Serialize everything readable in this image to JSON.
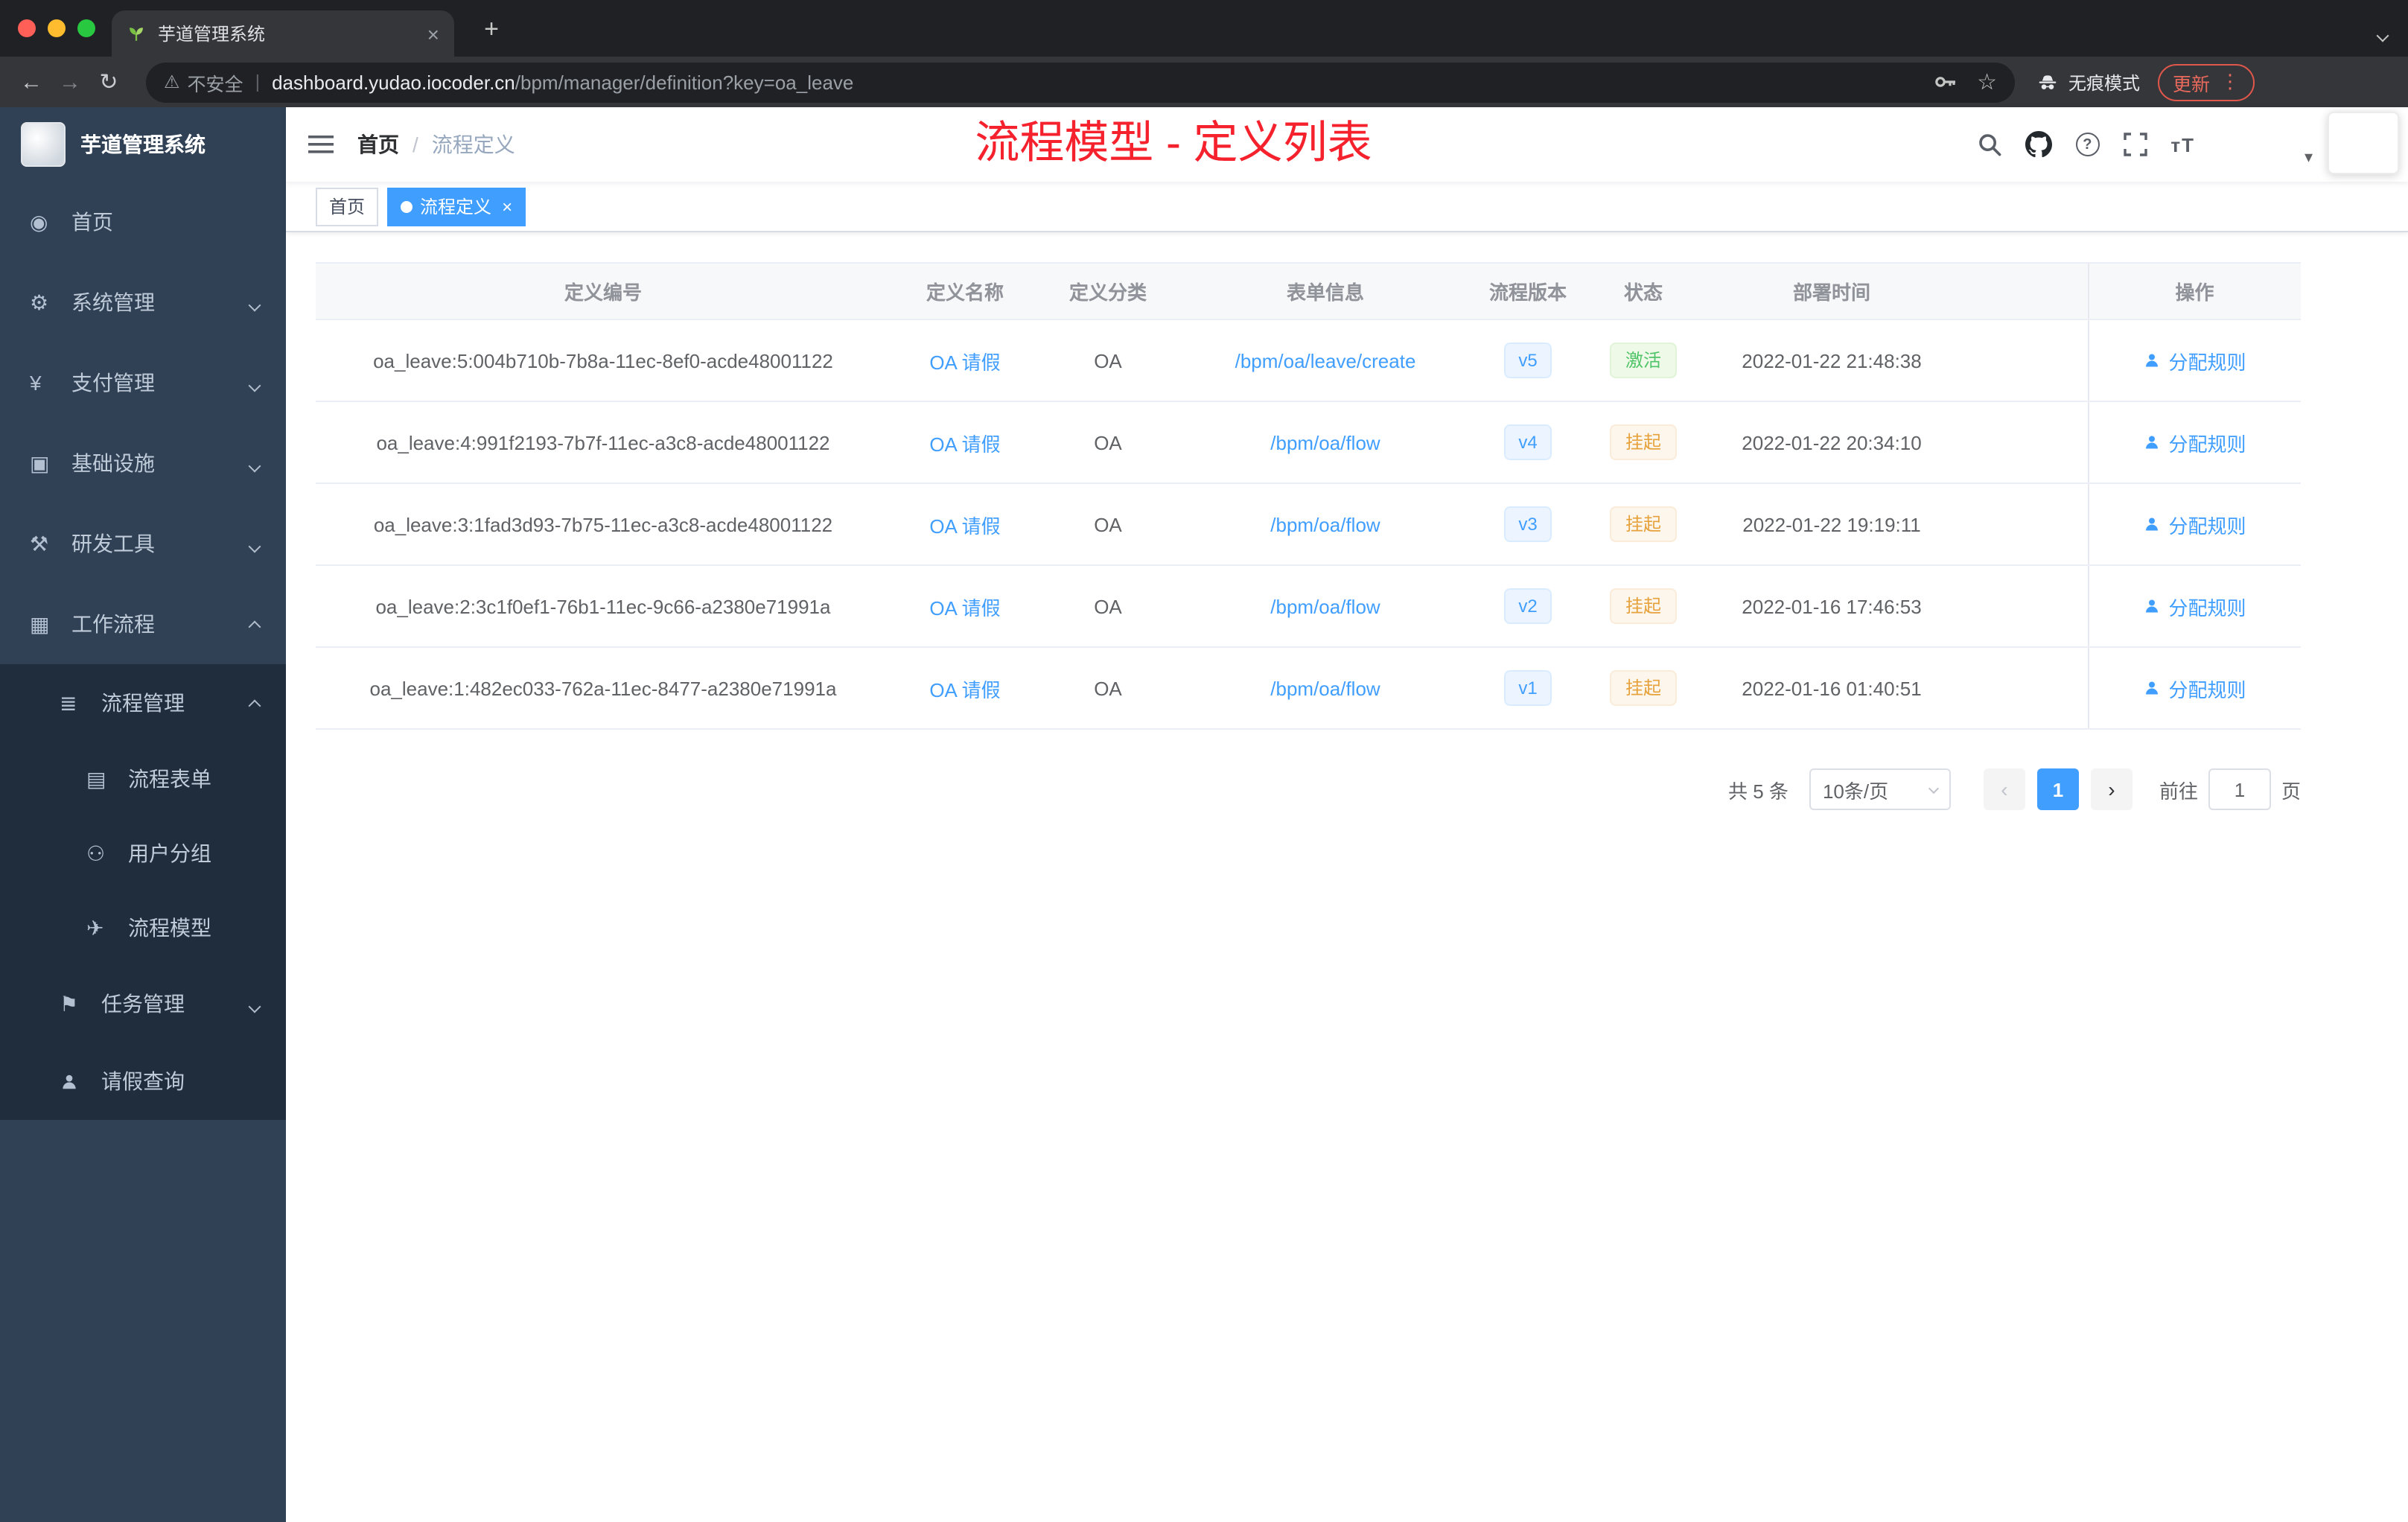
{
  "browser": {
    "tab": {
      "title": "芋道管理系统",
      "close": "×",
      "new_tab": "+"
    },
    "address": {
      "security": "不安全",
      "divider": "|",
      "host": "dashboard.yudao.iocoder.cn",
      "path": "/bpm/manager/definition?key=oa_leave"
    },
    "incognito_label": "无痕模式",
    "update_label": "更新"
  },
  "icons": {
    "back": "←",
    "forward": "→",
    "reload": "↻",
    "warning": "⚠",
    "star": "☆",
    "kebab": "⋮",
    "question": "?",
    "font_size": "тT",
    "caret_down": "▾",
    "dashboard": "◉",
    "gear": "⚙",
    "yen": "¥",
    "infrastructure": "▣",
    "tools": "⚒",
    "workflow": "▦",
    "process_manage": "≣",
    "process_form": "▤",
    "user_group": "⚇",
    "process_model": "✈",
    "task_manage": "⚑",
    "prev": "‹",
    "next": "›"
  },
  "sidebar": {
    "logo_title": "芋道管理系统",
    "items": [
      {
        "label": "首页"
      },
      {
        "label": "系统管理"
      },
      {
        "label": "支付管理"
      },
      {
        "label": "基础设施"
      },
      {
        "label": "研发工具"
      },
      {
        "label": "工作流程"
      },
      {
        "label": "流程管理"
      },
      {
        "label": "流程表单"
      },
      {
        "label": "用户分组"
      },
      {
        "label": "流程模型"
      },
      {
        "label": "任务管理"
      },
      {
        "label": "请假查询"
      }
    ]
  },
  "header": {
    "breadcrumb": {
      "home": "首页",
      "separator": "/",
      "current": "流程定义"
    },
    "annotation": "流程模型 - 定义列表",
    "annotation_color": "#f5222d"
  },
  "tags_view": {
    "tags": [
      {
        "label": "首页",
        "active": false
      },
      {
        "label": "流程定义",
        "active": true
      }
    ]
  },
  "table": {
    "columns": [
      "定义编号",
      "定义名称",
      "定义分类",
      "表单信息",
      "流程版本",
      "状态",
      "部署时间",
      "操作"
    ],
    "rows": [
      {
        "id": "oa_leave:5:004b710b-7b8a-11ec-8ef0-acde48001122",
        "name": "OA 请假",
        "category": "OA",
        "form": "/bpm/oa/leave/create",
        "version": "v5",
        "status": "激活",
        "status_type": "success",
        "deploy_time": "2022-01-22 21:48:38",
        "action": "分配规则"
      },
      {
        "id": "oa_leave:4:991f2193-7b7f-11ec-a3c8-acde48001122",
        "name": "OA 请假",
        "category": "OA",
        "form": "/bpm/oa/flow",
        "version": "v4",
        "status": "挂起",
        "status_type": "warning",
        "deploy_time": "2022-01-22 20:34:10",
        "action": "分配规则"
      },
      {
        "id": "oa_leave:3:1fad3d93-7b75-11ec-a3c8-acde48001122",
        "name": "OA 请假",
        "category": "OA",
        "form": "/bpm/oa/flow",
        "version": "v3",
        "status": "挂起",
        "status_type": "warning",
        "deploy_time": "2022-01-22 19:19:11",
        "action": "分配规则"
      },
      {
        "id": "oa_leave:2:3c1f0ef1-76b1-11ec-9c66-a2380e71991a",
        "name": "OA 请假",
        "category": "OA",
        "form": "/bpm/oa/flow",
        "version": "v2",
        "status": "挂起",
        "status_type": "warning",
        "deploy_time": "2022-01-16 17:46:53",
        "action": "分配规则"
      },
      {
        "id": "oa_leave:1:482ec033-762a-11ec-8477-a2380e71991a",
        "name": "OA 请假",
        "category": "OA",
        "form": "/bpm/oa/flow",
        "version": "v1",
        "status": "挂起",
        "status_type": "warning",
        "deploy_time": "2022-01-16 01:40:51",
        "action": "分配规则"
      }
    ]
  },
  "pagination": {
    "total_text": "共 5 条",
    "page_size_text": "10条/页",
    "page": "1",
    "goto_text": "前往",
    "goto_value": "1",
    "unit_text": "页"
  },
  "colors": {
    "accent": "#409eff",
    "success": "#67c23a",
    "warning": "#e6a23c",
    "sidebar_bg": "#304156"
  }
}
